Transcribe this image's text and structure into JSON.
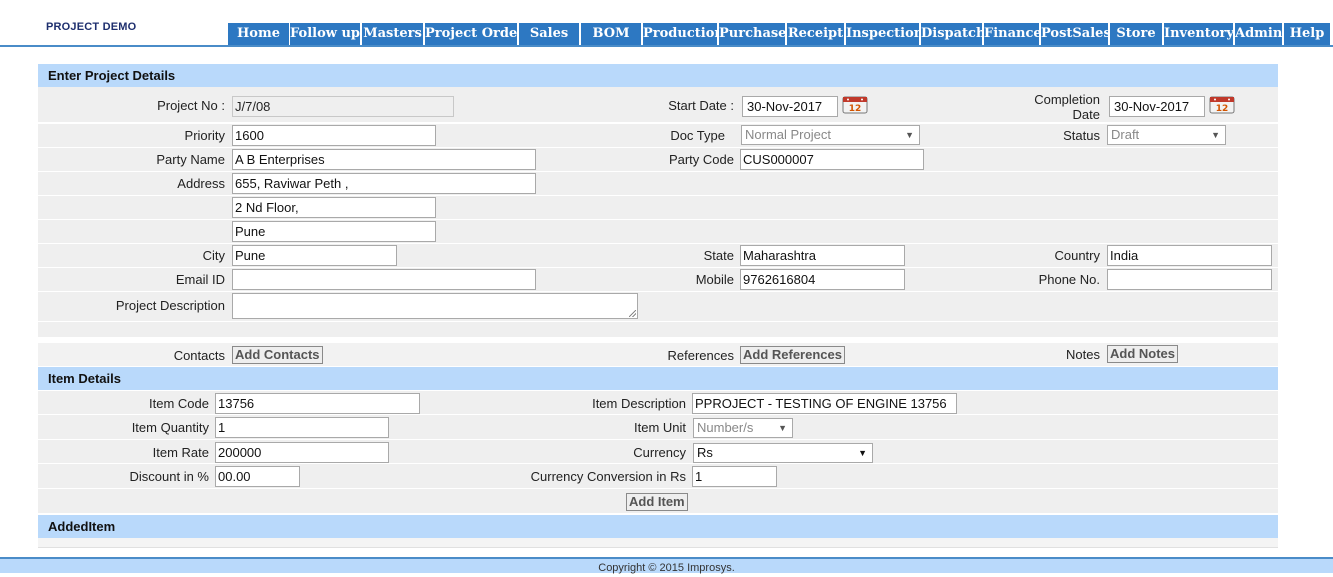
{
  "app": {
    "brand": "PROJECT DEMO"
  },
  "nav": [
    "Home",
    "Follow up",
    "Masters",
    "Project Order",
    "Sales",
    "BOM",
    "Production",
    "Purchase",
    "Receipt",
    "Inspection",
    "Dispatch",
    "Finance",
    "PostSales",
    "Store",
    "Inventory",
    "Admin",
    "Help"
  ],
  "project": {
    "section_title": "Enter Project Details",
    "project_no_label": "Project No :",
    "project_no": "J/7/08",
    "start_date_label": "Start Date :",
    "start_date": "30-Nov-2017",
    "completion_label_1": "Completion",
    "completion_label_2": "Date",
    "completion_date": "30-Nov-2017",
    "priority_label": "Priority",
    "priority": "1600",
    "doc_type_label": "Doc Type",
    "doc_type": "Normal Project",
    "status_label": "Status",
    "status": "Draft",
    "party_name_label": "Party Name",
    "party_name": "A B Enterprises",
    "party_code_label": "Party Code",
    "party_code": "CUS000007",
    "address_label": "Address",
    "address_1": "655, Raviwar Peth ,",
    "address_2": "2 Nd Floor,",
    "address_3": "Pune",
    "city_label": "City",
    "city": "Pune",
    "state_label": "State",
    "state": "Maharashtra",
    "country_label": "Country",
    "country": "India",
    "email_label": "Email ID",
    "email": "",
    "mobile_label": "Mobile",
    "mobile": "9762616804",
    "phone_label": "Phone No.",
    "phone": "",
    "description_label": "Project Description",
    "description": "",
    "contacts_label": "Contacts",
    "add_contacts": "Add Contacts",
    "references_label": "References",
    "add_references": "Add References",
    "notes_label": "Notes",
    "add_notes": "Add Notes"
  },
  "item": {
    "section_title": "Item Details",
    "code_label": "Item Code",
    "code": "13756",
    "desc_label": "Item Description",
    "desc": "PPROJECT - TESTING OF ENGINE 13756",
    "qty_label": "Item Quantity",
    "qty": "1",
    "unit_label": "Item Unit",
    "unit": "Number/s",
    "rate_label": "Item Rate",
    "rate": "200000",
    "currency_label": "Currency",
    "currency": "Rs",
    "discount_label": "Discount in %",
    "discount": "00.00",
    "conversion_label": "Currency Conversion in Rs",
    "conversion": "1",
    "add_item": "Add Item"
  },
  "added": {
    "section_title": "AddedItem"
  },
  "footer": {
    "copyright": "Copyright © 2015 Improsys."
  },
  "icons": {
    "calendar": "calendar-icon",
    "dropdown": "dropdown-arrow-icon"
  },
  "colors": {
    "nav_bg": "#2d78c2",
    "section_bg": "#b9d9fb",
    "row_bg": "#efefef",
    "brand": "#1e2f6e"
  }
}
